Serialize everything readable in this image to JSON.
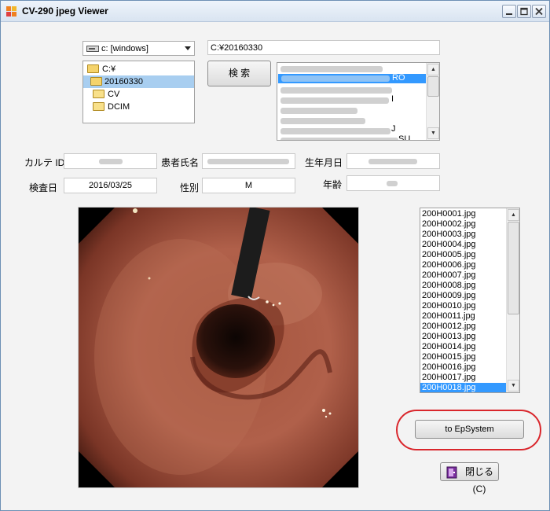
{
  "window": {
    "title": "CV-290  jpeg Viewer"
  },
  "drive": {
    "selected": "c: [windows]"
  },
  "path": {
    "value": "C:¥20160330"
  },
  "folders": [
    {
      "label": "C:¥",
      "selected": false
    },
    {
      "label": "20160330",
      "selected": true
    },
    {
      "label": "CV",
      "selected": false
    },
    {
      "label": "DCIM",
      "selected": false
    }
  ],
  "search_button": {
    "label": "検 索"
  },
  "patients": {
    "rows": [
      {
        "text": "",
        "selected": false
      },
      {
        "text": "RO",
        "selected": true
      },
      {
        "text": "",
        "selected": false
      },
      {
        "text": "I",
        "selected": false
      },
      {
        "text": "",
        "selected": false
      },
      {
        "text": "",
        "selected": false
      },
      {
        "text": "",
        "selected": false
      },
      {
        "text": "J",
        "selected": false
      },
      {
        "text": "SU",
        "selected": false
      }
    ]
  },
  "info": {
    "karte_label": "カルテ ID",
    "karte_value": "",
    "patient_name_label": "患者氏名",
    "patient_name_value": "",
    "birth_label": "生年月日",
    "birth_value": "",
    "exam_date_label": "検査日",
    "exam_date_value": "2016/03/25",
    "sex_label": "性別",
    "sex_value": "M",
    "age_label": "年齢",
    "age_value": ""
  },
  "files": [
    {
      "name": "200H0001.jpg",
      "selected": false
    },
    {
      "name": "200H0002.jpg",
      "selected": false
    },
    {
      "name": "200H0003.jpg",
      "selected": false
    },
    {
      "name": "200H0004.jpg",
      "selected": false
    },
    {
      "name": "200H0005.jpg",
      "selected": false
    },
    {
      "name": "200H0006.jpg",
      "selected": false
    },
    {
      "name": "200H0007.jpg",
      "selected": false
    },
    {
      "name": "200H0008.jpg",
      "selected": false
    },
    {
      "name": "200H0009.jpg",
      "selected": false
    },
    {
      "name": "200H0010.jpg",
      "selected": false
    },
    {
      "name": "200H0011.jpg",
      "selected": false
    },
    {
      "name": "200H0012.jpg",
      "selected": false
    },
    {
      "name": "200H0013.jpg",
      "selected": false
    },
    {
      "name": "200H0014.jpg",
      "selected": false
    },
    {
      "name": "200H0015.jpg",
      "selected": false
    },
    {
      "name": "200H0016.jpg",
      "selected": false
    },
    {
      "name": "200H0017.jpg",
      "selected": false
    },
    {
      "name": "200H0018.jpg",
      "selected": true
    }
  ],
  "export_button": {
    "label": "to EpSystem"
  },
  "close_button": {
    "label": "閉じる(C)"
  },
  "colors": {
    "highlight": "#3399ff",
    "annotation_ring": "#d9262c",
    "title_bg": "#dbe6f4"
  }
}
